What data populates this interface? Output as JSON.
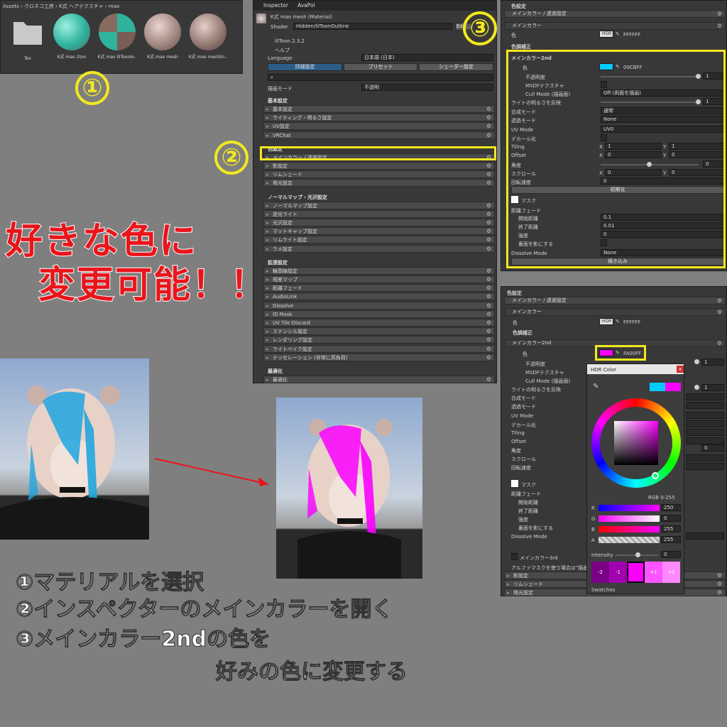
{
  "project": {
    "breadcrumb": "Assets › クロネコ工房 › K式 ヘアテクスチャ › mao",
    "items": [
      {
        "label": "Tex"
      },
      {
        "label": "K式 mao 2ton"
      },
      {
        "label": "K式 mao lilToonIo.."
      },
      {
        "label": "K式 mao mesh"
      },
      {
        "label": "K式 mao meshlin.."
      }
    ]
  },
  "inspector": {
    "tabs": [
      "Inspector",
      "AvaPol"
    ],
    "material_name": "K式 mao mesh (Material)",
    "shader_label": "Shader",
    "shader_value": "Hidden/lilToonOutline",
    "edit_label": "Edit...",
    "version": "lilToon 2.3.2",
    "help": "ヘルプ",
    "language_label": "Language",
    "language_value": "日本語 (日本)",
    "mode_tabs": [
      "詳細設定",
      "プリセット",
      "シェーダー設定"
    ],
    "render_mode_label": "描画モード",
    "render_mode_value": "不透明",
    "sections": [
      {
        "title": "基本設定",
        "items": [
          "基本設定",
          "ライティング・明るさ設定",
          "UV設定",
          "VRChat"
        ]
      },
      {
        "title": "色設定",
        "items": [
          "メインカラー / 透過設定",
          "影設定",
          "リムシェード",
          "発光設定"
        ]
      },
      {
        "title": "ノーマルマップ・光沢設定",
        "items": [
          "ノーマルマップ設定",
          "逆光ライト",
          "光沢設定",
          "マットキャップ設定",
          "リムライト設定",
          "ラメ設定"
        ]
      },
      {
        "title": "拡張設定",
        "items": [
          "輪郭線設定",
          "視差マップ",
          "距離フェード",
          "AudioLink",
          "Dissolve",
          "ID Mask",
          "UV Tile Discard",
          "ステンシル設定",
          "レンダリング設定",
          "ライトベイク設定",
          "テッセレーション (非常に高負荷)"
        ]
      },
      {
        "title": "最適化",
        "items": [
          "最適化"
        ]
      }
    ]
  },
  "panel3": {
    "top_title": "色設定",
    "main_color_header": "メインカラー / 透過設定",
    "main_color_label": "メインカラー",
    "color_label": "色",
    "hdr": "HDR",
    "main_color_hex": "FFFFFF",
    "color_correction": "色調補正",
    "second_header": "メインカラー2nd",
    "second_color_hex": "00CBFF",
    "opacity_label": "不透明度",
    "opacity_value": "1",
    "msdf_label": "MSDFテクスチャ",
    "cull_label": "Cull Mode (描画面)",
    "cull_value": "Off (両面を描画)",
    "light_label": "ライトの明るさを反映",
    "light_value": "1",
    "blend_label": "合成モード",
    "blend_value": "通常",
    "transparency_label": "透過モード",
    "transparency_value": "None",
    "uvmode_label": "UV Mode",
    "uvmode_value": "UV0",
    "decal_label": "デカール化",
    "tiling_label": "Tiling",
    "tiling_x": "1",
    "tiling_y": "1",
    "offset_label": "Offset",
    "offset_x": "0",
    "offset_y": "0",
    "angle_label": "角度",
    "angle_value": "0",
    "scroll_label": "スクロール",
    "scroll_x": "0",
    "scroll_y": "0",
    "rotate_label": "回転速度",
    "rotate_value": "0",
    "init_button": "初期化",
    "mask_label": "マスク",
    "fade_label": "距離フェード",
    "fade_start_label": "開始距離",
    "fade_start": "0.1",
    "fade_end_label": "終了距離",
    "fade_end": "0.01",
    "strength_label": "強度",
    "strength_value": "0",
    "backface_label": "裏面を影にする",
    "dissolve_label": "Dissolve Mode",
    "dissolve_value": "None",
    "bake_button": "焼き込み",
    "x": "X",
    "y": "Y"
  },
  "panel4": {
    "top_title": "色設定",
    "main_color_header": "メインカラー / 透過設定",
    "main_color_label": "メインカラー",
    "color_label": "色",
    "hdr": "HDR",
    "main_color_hex": "FFFFFF",
    "color_correction": "色調補正",
    "second_header": "メインカラー2nd",
    "second_color_hex": "FA00FF",
    "opacity_label": "不透明度",
    "opacity_value": "1",
    "msdf_label": "MSDFテクスチャ",
    "cull_label": "Cull Mode (描画面)",
    "light_label": "ライトの明るさを反映",
    "light_value": "1",
    "left_labels": [
      "合成モード",
      "透過モード",
      "UV Mode",
      "デカール化",
      "Tiling",
      "Offset",
      "角度",
      "スクロール",
      "回転速度"
    ],
    "angle_value": "0",
    "mask_label": "マスク",
    "fade_label": "距離フェード",
    "fade_labels": [
      "開始距離",
      "終了距離",
      "強度",
      "裏面を影にする"
    ],
    "dissolve_label": "Dissolve Mode",
    "third_header": "メインカラー3rd",
    "alpha_note": "アルファマスクを使う場合は\"描画モード",
    "bottom_items": [
      "影設定",
      "リムシェード",
      "発光設定"
    ]
  },
  "hdr_picker": {
    "title": "HDR Color",
    "close": "x",
    "mode": "RGB 0-255",
    "channels": [
      {
        "label": "R",
        "value": "250"
      },
      {
        "label": "G",
        "value": "0"
      },
      {
        "label": "B",
        "value": "255"
      },
      {
        "label": "A",
        "value": "255"
      }
    ],
    "intensity_label": "Intensity",
    "intensity_value": "0",
    "swatch_labels": [
      "-2",
      "-1",
      "",
      "+1",
      "+2"
    ],
    "swatches_label": "Swatches",
    "current_color": "#fa00ff",
    "previous_color": "#00cbff"
  },
  "annotations": {
    "num1": "①",
    "num2": "②",
    "num3": "③",
    "headline_line1": "好きな色に",
    "headline_line2": "変更可能！！",
    "step1": "①マテリアルを選択",
    "step2": "②インスペクターのメインカラーを開く",
    "step3": "③メインカラー2ndの色を",
    "step3b": "好みの色に変更する"
  },
  "colors": {
    "highlight": "#f2e81e",
    "headline": "#e8151b",
    "cyan": "#00cbff",
    "magenta": "#fa00ff"
  }
}
